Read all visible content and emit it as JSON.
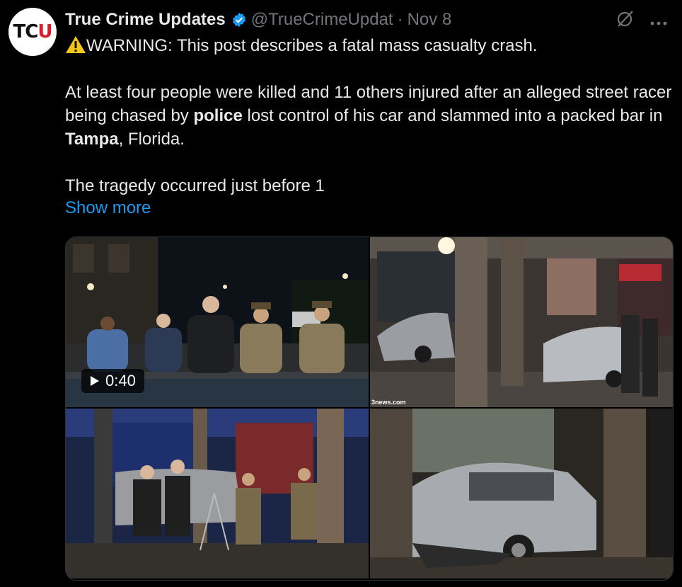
{
  "tweet": {
    "avatar_text": "TCU",
    "display_name": "True Crime Updates",
    "handle": "@TrueCrimeUpdat",
    "separator": "·",
    "date": "Nov 8",
    "warning_text": "WARNING: This post describes a fatal mass casualty crash.",
    "para1_a": "At least four people were killed and 11 others injured after an alleged street racer being chased by ",
    "para1_b": "police",
    "para1_c": " lost control of his car and slammed into a packed bar in ",
    "para1_d": "Tampa",
    "para1_e": ", Florida.",
    "para2": "The tragedy occurred just before 1",
    "show_more": "Show more"
  },
  "media": {
    "video_duration": "0:40",
    "watermark": "3news.com"
  },
  "icons": {
    "verified": "verified-badge-icon",
    "warning": "warning-icon",
    "grok": "grok-icon",
    "more": "more-icon",
    "play": "play-icon"
  },
  "colors": {
    "accent": "#1d9bf0",
    "verified": "#1d9bf0"
  }
}
